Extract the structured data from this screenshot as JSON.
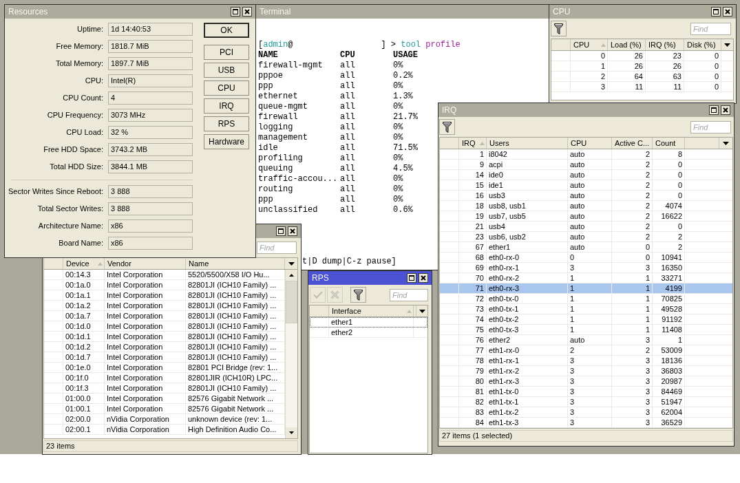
{
  "resources": {
    "title": "Resources",
    "active": false,
    "fields": [
      {
        "label": "Uptime:",
        "value": "1d 14:40:53"
      },
      {
        "label": "Free Memory:",
        "value": "1818.7 MiB"
      },
      {
        "label": "Total Memory:",
        "value": "1897.7 MiB"
      },
      {
        "label": "CPU:",
        "value": "Intel(R)"
      },
      {
        "label": "CPU Count:",
        "value": "4"
      },
      {
        "label": "CPU Frequency:",
        "value": "3073 MHz"
      },
      {
        "label": "CPU Load:",
        "value": "32 %"
      },
      {
        "label": "Free HDD Space:",
        "value": "3743.2 MB"
      },
      {
        "label": "Total HDD Size:",
        "value": "3844.1 MB"
      }
    ],
    "write_fields": [
      {
        "label": "Sector Writes Since Reboot:",
        "value": "3 888"
      },
      {
        "label": "Total Sector Writes:",
        "value": "3 888"
      },
      {
        "label": "Architecture Name:",
        "value": "x86"
      },
      {
        "label": "Board Name:",
        "value": "x86"
      }
    ],
    "buttons": [
      {
        "label": "OK",
        "default": true
      },
      {
        "label": "PCI",
        "default": false
      },
      {
        "label": "USB",
        "default": false
      },
      {
        "label": "CPU",
        "default": false
      },
      {
        "label": "IRQ",
        "default": false
      },
      {
        "label": "RPS",
        "default": false
      },
      {
        "label": "Hardware",
        "default": false
      }
    ]
  },
  "terminal": {
    "title": "Terminal",
    "active": false,
    "prompt": {
      "open": "[",
      "user": "admin",
      "at": "@",
      "close": "] >",
      "command": "tool",
      "argument": "profile"
    },
    "columns": [
      "NAME",
      "CPU",
      "USAGE"
    ],
    "rows": [
      [
        "firewall-mgmt",
        "all",
        "0%"
      ],
      [
        "pppoe",
        "all",
        "0.2%"
      ],
      [
        "ppp",
        "all",
        "0%"
      ],
      [
        "ethernet",
        "all",
        "1.3%"
      ],
      [
        "queue-mgmt",
        "all",
        "0%"
      ],
      [
        "firewall",
        "all",
        "21.7%"
      ],
      [
        "logging",
        "all",
        "0%"
      ],
      [
        "management",
        "all",
        "0%"
      ],
      [
        "idle",
        "all",
        "71.5%"
      ],
      [
        "profiling",
        "all",
        "0%"
      ],
      [
        "queuing",
        "all",
        "4.5%"
      ],
      [
        "traffic-accou...",
        "all",
        "0%"
      ],
      [
        "routing",
        "all",
        "0%"
      ],
      [
        "ppp",
        "all",
        "0%"
      ],
      [
        "unclassified",
        "all",
        "0.6%"
      ]
    ],
    "hint": "t|D dump|C-z pause]"
  },
  "cpu": {
    "title": "CPU",
    "active": false,
    "toolbar": [
      {
        "kind": "filter",
        "disabled": false
      }
    ],
    "find": {
      "placeholder": "Find"
    },
    "columns": [
      {
        "label": "CPU",
        "sorted": true
      },
      {
        "label": "Load (%)",
        "sorted": false
      },
      {
        "label": "IRQ (%)",
        "sorted": false
      },
      {
        "label": "Disk (%)",
        "sorted": false
      }
    ],
    "rows": [
      {
        "cells": [
          "0",
          "26",
          "23",
          "0"
        ],
        "selected": false
      },
      {
        "cells": [
          "1",
          "26",
          "26",
          "0"
        ],
        "selected": false
      },
      {
        "cells": [
          "2",
          "64",
          "63",
          "0"
        ],
        "selected": false
      },
      {
        "cells": [
          "3",
          "11",
          "11",
          "0"
        ],
        "selected": false
      }
    ]
  },
  "irq": {
    "title": "IRQ",
    "active": false,
    "toolbar": [
      {
        "kind": "filter",
        "disabled": false
      }
    ],
    "find": {
      "placeholder": "Find"
    },
    "columns": [
      {
        "label": "IRQ",
        "sorted": true
      },
      {
        "label": "Users",
        "sorted": false
      },
      {
        "label": "CPU",
        "sorted": false
      },
      {
        "label": "Active C...",
        "sorted": false
      },
      {
        "label": "Count",
        "sorted": false
      }
    ],
    "rows": [
      {
        "cells": [
          "1",
          "i8042",
          "auto",
          "2",
          "8"
        ],
        "selected": false
      },
      {
        "cells": [
          "9",
          "acpi",
          "auto",
          "2",
          "0"
        ],
        "selected": false
      },
      {
        "cells": [
          "14",
          "ide0",
          "auto",
          "2",
          "0"
        ],
        "selected": false
      },
      {
        "cells": [
          "15",
          "ide1",
          "auto",
          "2",
          "0"
        ],
        "selected": false
      },
      {
        "cells": [
          "16",
          "usb3",
          "auto",
          "2",
          "0"
        ],
        "selected": false
      },
      {
        "cells": [
          "18",
          "usb8, usb1",
          "auto",
          "2",
          "4074"
        ],
        "selected": false
      },
      {
        "cells": [
          "19",
          "usb7, usb5",
          "auto",
          "2",
          "16622"
        ],
        "selected": false
      },
      {
        "cells": [
          "21",
          "usb4",
          "auto",
          "2",
          "0"
        ],
        "selected": false
      },
      {
        "cells": [
          "23",
          "usb6, usb2",
          "auto",
          "2",
          "2"
        ],
        "selected": false
      },
      {
        "cells": [
          "67",
          "ether1",
          "auto",
          "0",
          "2"
        ],
        "selected": false
      },
      {
        "cells": [
          "68",
          "eth0-rx-0",
          "0",
          "0",
          "10941"
        ],
        "selected": false
      },
      {
        "cells": [
          "69",
          "eth0-rx-1",
          "3",
          "3",
          "16350"
        ],
        "selected": false
      },
      {
        "cells": [
          "70",
          "eth0-rx-2",
          "1",
          "1",
          "33271"
        ],
        "selected": false
      },
      {
        "cells": [
          "71",
          "eth0-rx-3",
          "1",
          "1",
          "4199"
        ],
        "selected": true
      },
      {
        "cells": [
          "72",
          "eth0-tx-0",
          "1",
          "1",
          "70825"
        ],
        "selected": false
      },
      {
        "cells": [
          "73",
          "eth0-tx-1",
          "1",
          "1",
          "49528"
        ],
        "selected": false
      },
      {
        "cells": [
          "74",
          "eth0-tx-2",
          "1",
          "1",
          "91192"
        ],
        "selected": false
      },
      {
        "cells": [
          "75",
          "eth0-tx-3",
          "1",
          "1",
          "11408"
        ],
        "selected": false
      },
      {
        "cells": [
          "76",
          "ether2",
          "auto",
          "3",
          "1"
        ],
        "selected": false
      },
      {
        "cells": [
          "77",
          "eth1-rx-0",
          "2",
          "2",
          "53009"
        ],
        "selected": false
      },
      {
        "cells": [
          "78",
          "eth1-rx-1",
          "3",
          "3",
          "18136"
        ],
        "selected": false
      },
      {
        "cells": [
          "79",
          "eth1-rx-2",
          "3",
          "3",
          "36803"
        ],
        "selected": false
      },
      {
        "cells": [
          "80",
          "eth1-rx-3",
          "3",
          "3",
          "20987"
        ],
        "selected": false
      },
      {
        "cells": [
          "81",
          "eth1-tx-0",
          "3",
          "3",
          "84469"
        ],
        "selected": false
      },
      {
        "cells": [
          "82",
          "eth1-tx-1",
          "3",
          "3",
          "51947"
        ],
        "selected": false
      },
      {
        "cells": [
          "83",
          "eth1-tx-2",
          "3",
          "3",
          "62004"
        ],
        "selected": false
      },
      {
        "cells": [
          "84",
          "eth1-tx-3",
          "3",
          "3",
          "36529"
        ],
        "selected": false
      }
    ],
    "status": "27 items (1 selected)"
  },
  "pci": {
    "active": false,
    "find": {
      "placeholder": "Find"
    },
    "columns": [
      {
        "label": "Device",
        "sorted": true
      },
      {
        "label": "Vendor",
        "sorted": false
      },
      {
        "label": "Name",
        "sorted": false
      }
    ],
    "rows": [
      {
        "cells": [
          "00:14.3",
          "Intel Corporation",
          "5520/5500/X58 I/O Hu..."
        ],
        "selected": false
      },
      {
        "cells": [
          "00:1a.0",
          "Intel Corporation",
          "82801JI (ICH10 Family) ..."
        ],
        "selected": false
      },
      {
        "cells": [
          "00:1a.1",
          "Intel Corporation",
          "82801JI (ICH10 Family) ..."
        ],
        "selected": false
      },
      {
        "cells": [
          "00:1a.2",
          "Intel Corporation",
          "82801JI (ICH10 Family) ..."
        ],
        "selected": false
      },
      {
        "cells": [
          "00:1a.7",
          "Intel Corporation",
          "82801JI (ICH10 Family) ..."
        ],
        "selected": false
      },
      {
        "cells": [
          "00:1d.0",
          "Intel Corporation",
          "82801JI (ICH10 Family) ..."
        ],
        "selected": false
      },
      {
        "cells": [
          "00:1d.1",
          "Intel Corporation",
          "82801JI (ICH10 Family) ..."
        ],
        "selected": false
      },
      {
        "cells": [
          "00:1d.2",
          "Intel Corporation",
          "82801JI (ICH10 Family) ..."
        ],
        "selected": false
      },
      {
        "cells": [
          "00:1d.7",
          "Intel Corporation",
          "82801JI (ICH10 Family) ..."
        ],
        "selected": false
      },
      {
        "cells": [
          "00:1e.0",
          "Intel Corporation",
          "82801 PCI Bridge (rev: 1..."
        ],
        "selected": false
      },
      {
        "cells": [
          "00:1f.0",
          "Intel Corporation",
          "82801JIR (ICH10R) LPC..."
        ],
        "selected": false
      },
      {
        "cells": [
          "00:1f.3",
          "Intel Corporation",
          "82801JI (ICH10 Family) ..."
        ],
        "selected": false
      },
      {
        "cells": [
          "01:00.0",
          "Intel Corporation",
          "82576 Gigabit Network ..."
        ],
        "selected": false
      },
      {
        "cells": [
          "01:00.1",
          "Intel Corporation",
          "82576 Gigabit Network ..."
        ],
        "selected": false
      },
      {
        "cells": [
          "02:00.0",
          "nVidia Corporation",
          "unknown device (rev: 1..."
        ],
        "selected": false
      },
      {
        "cells": [
          "02:00.1",
          "nVidia Corporation",
          "High Definition Audio Co..."
        ],
        "selected": false
      }
    ],
    "status": "23 items"
  },
  "rps": {
    "title": "RPS",
    "active": true,
    "toolbar": [
      {
        "kind": "enable",
        "disabled": true
      },
      {
        "kind": "disable",
        "disabled": true
      },
      {
        "kind": "filter",
        "disabled": false
      }
    ],
    "find": {
      "placeholder": "Find"
    },
    "columns": [
      {
        "label": "Interface",
        "sorted": true
      }
    ],
    "rows": [
      {
        "cells": [
          "ether1"
        ],
        "selected": false,
        "focused": true
      },
      {
        "cells": [
          "ether2"
        ],
        "selected": false,
        "focused": false
      }
    ]
  }
}
